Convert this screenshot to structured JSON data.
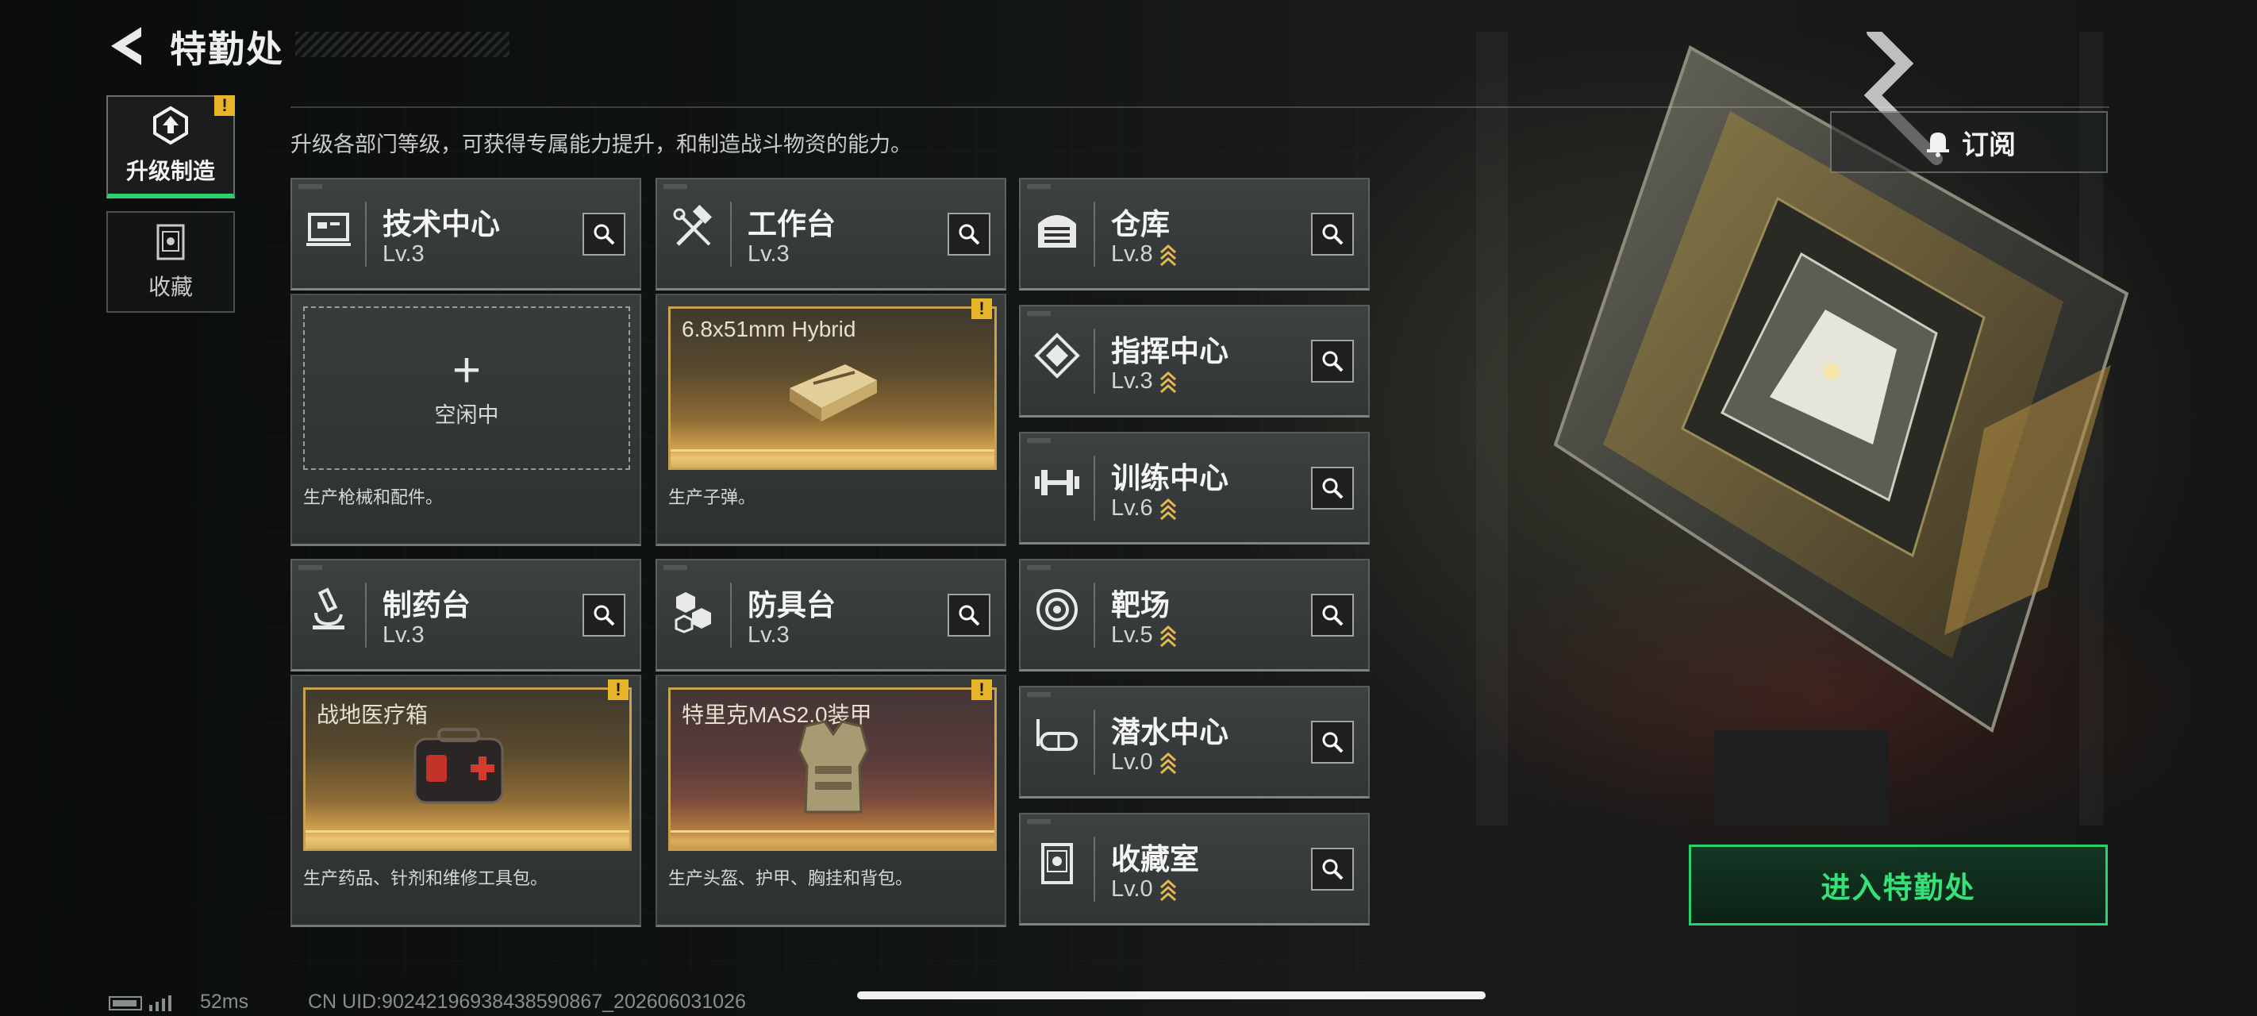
{
  "header": {
    "title": "特勤处"
  },
  "tabs": [
    {
      "label": "升级制造",
      "active": true,
      "alert": "!"
    },
    {
      "label": "收藏",
      "active": false
    }
  ],
  "subtitle": "升级各部门等级，可获得专属能力提升，和制造战斗物资的能力。",
  "subscribe_label": "订阅",
  "departments": {
    "tech": {
      "name": "技术中心",
      "level": "Lv.3"
    },
    "workbench": {
      "name": "工作台",
      "level": "Lv.3"
    },
    "pharmacy": {
      "name": "制药台",
      "level": "Lv.3"
    },
    "armor": {
      "name": "防具台",
      "level": "Lv.3"
    },
    "warehouse": {
      "name": "仓库",
      "level": "Lv.8"
    },
    "command": {
      "name": "指挥中心",
      "level": "Lv.3"
    },
    "training": {
      "name": "训练中心",
      "level": "Lv.6"
    },
    "range": {
      "name": "靶场",
      "level": "Lv.5"
    },
    "diving": {
      "name": "潜水中心",
      "level": "Lv.0"
    },
    "collection": {
      "name": "收藏室",
      "level": "Lv.0"
    }
  },
  "production": {
    "tech": {
      "slot_status": "空闲中",
      "description": "生产枪械和配件。"
    },
    "workbench": {
      "item": "6.8x51mm Hybrid",
      "alert": "!",
      "description": "生产子弹。"
    },
    "pharmacy": {
      "item": "战地医疗箱",
      "alert": "!",
      "description": "生产药品、针剂和维修工具包。"
    },
    "armor": {
      "item": "特里克MAS2.0装甲",
      "alert": "!",
      "description": "生产头盔、护甲、胸挂和背包。"
    }
  },
  "enter_button": "进入特勤处",
  "status": {
    "ping": "52ms",
    "uid": "CN UID:90242196938438590867_202606031026"
  },
  "colors": {
    "accent_green": "#2bd16c",
    "alert_yellow": "#e8b52a",
    "gold": "#c9a24b"
  }
}
